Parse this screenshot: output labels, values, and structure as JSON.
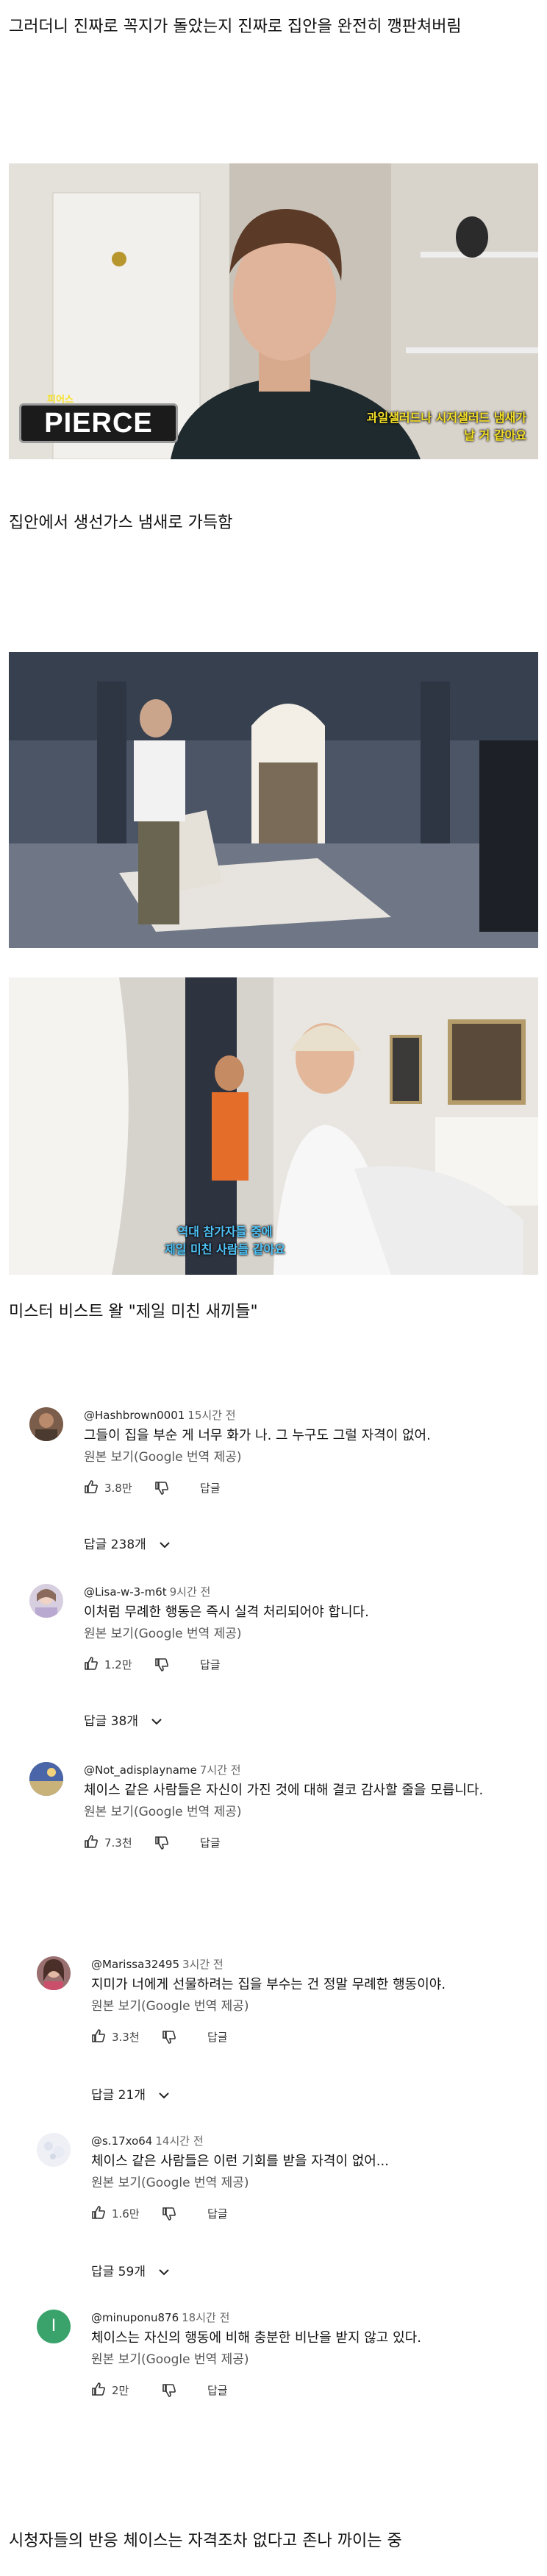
{
  "captions": {
    "top": "그러더니 진짜로 꼭지가 돌았는지 진짜로 집안을 완전히 깽판쳐버림",
    "middle": "집안에서 생선가스 냄새로 가득함",
    "quote": "미스터 비스트 왈 \"제일 미친 새끼들\"",
    "bottom": "시청자들의 반응 체이스는 자격조차 없다고 존나 까이는 중"
  },
  "photo1": {
    "name_tag_small": "피어스",
    "name_tag": "PIERCE",
    "subtitle_line1": "과일샐러드나 시저샐러드 냄새가",
    "subtitle_line2": "날 거 같아요"
  },
  "photo3": {
    "subtitle_line1": "역대 참가자들 중에",
    "subtitle_line2": "제일 미친 사람들 같아요"
  },
  "comments": [
    {
      "user": "@Hashbrown0001",
      "time": "15시간 전",
      "text": "그들이 집을 부순 게 너무 화가 나. 그 누구도 그럴 자격이 없어.",
      "translate": "원본 보기(Google 번역 제공)",
      "likes": "3.8만",
      "reply": "답글",
      "replies": "답글 238개"
    },
    {
      "user": "@Lisa-w-3-m6t",
      "time": "9시간 전",
      "text": "이처럼 무례한 행동은 즉시 실격 처리되어야 합니다.",
      "translate": "원본 보기(Google 번역 제공)",
      "likes": "1.2만",
      "reply": "답글",
      "replies": "답글 38개"
    },
    {
      "user": "@Not_adisplayname",
      "time": "7시간 전",
      "text": "체이스 같은 사람들은 자신이 가진 것에 대해 결코 감사할 줄을 모릅니다.",
      "translate": "원본 보기(Google 번역 제공)",
      "likes": "7.3천",
      "reply": "답글",
      "replies": ""
    },
    {
      "user": "@Marissa32495",
      "time": "3시간 전",
      "text": "지미가 너에게 선물하려는 집을 부수는 건 정말 무례한 행동이야.",
      "translate": "원본 보기(Google 번역 제공)",
      "likes": "3.3천",
      "reply": "답글",
      "replies": "답글 21개"
    },
    {
      "user": "@s.17xo64",
      "time": "14시간 전",
      "text": "체이스 같은 사람들은 이런 기회를 받을 자격이 없어...",
      "translate": "원본 보기(Google 번역 제공)",
      "likes": "1.6만",
      "reply": "답글",
      "replies": "답글 59개"
    },
    {
      "user": "@minuponu876",
      "time": "18시간 전",
      "text": "체이스는 자신의 행동에 비해 충분한 비난을 받지 않고 있다.",
      "translate": "원본 보기(Google 번역 제공)",
      "likes": "2만",
      "reply": "답글",
      "replies": "",
      "avatar_letter": "I"
    }
  ],
  "colors": {
    "avatar_green": "#3aa36b",
    "subtitle_yellow": "#f5e027",
    "subtitle_blue": "#4fc3f7"
  }
}
